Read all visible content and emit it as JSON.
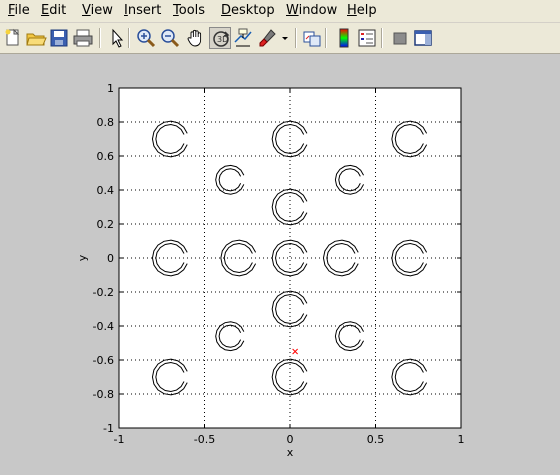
{
  "menubar": {
    "items": [
      {
        "label": "File",
        "key": "F",
        "rest": "ile"
      },
      {
        "label": "Edit",
        "key": "E",
        "rest": "dit"
      },
      {
        "label": "View",
        "key": "V",
        "rest": "iew"
      },
      {
        "label": "Insert",
        "key": "I",
        "rest": "nsert"
      },
      {
        "label": "Tools",
        "key": "T",
        "rest": "ools"
      },
      {
        "label": "Desktop",
        "key": "D",
        "rest": "esktop"
      },
      {
        "label": "Window",
        "key": "W",
        "rest": "indow"
      },
      {
        "label": "Help",
        "key": "H",
        "rest": "elp"
      }
    ]
  },
  "toolbar": {
    "buttons": [
      {
        "name": "new-figure-icon"
      },
      {
        "name": "open-file-icon"
      },
      {
        "name": "save-icon"
      },
      {
        "name": "print-icon"
      },
      {
        "name": "edit-plot-arrow-icon"
      },
      {
        "name": "zoom-in-icon"
      },
      {
        "name": "zoom-out-icon"
      },
      {
        "name": "pan-hand-icon"
      },
      {
        "name": "rotate-3d-icon",
        "active": true
      },
      {
        "name": "data-cursor-icon"
      },
      {
        "name": "brush-icon"
      },
      {
        "name": "link-plot-icon"
      },
      {
        "name": "insert-colorbar-icon"
      },
      {
        "name": "insert-legend-icon"
      },
      {
        "name": "hide-plot-tools-icon"
      },
      {
        "name": "show-plot-tools-icon"
      }
    ]
  },
  "chart_data": {
    "type": "scatter",
    "title": "",
    "xlabel": "x",
    "ylabel": "y",
    "xlim": [
      -1,
      1
    ],
    "ylim": [
      -1,
      1
    ],
    "xticks": [
      -1,
      -0.5,
      0,
      0.5,
      1
    ],
    "xtick_labels": [
      "-1",
      "-0.5",
      "0",
      "0.5",
      "1"
    ],
    "yticks": [
      -1,
      -0.8,
      -0.6,
      -0.4,
      -0.2,
      0,
      0.2,
      0.4,
      0.6,
      0.8,
      1
    ],
    "ytick_labels": [
      "-1",
      "-0.8",
      "-0.6",
      "-0.4",
      "-0.2",
      "0",
      "0.2",
      "0.4",
      "0.6",
      "0.8",
      "1"
    ],
    "grid": true,
    "grid_x": [
      -0.5,
      0,
      0.5
    ],
    "grid_y": [
      -0.8,
      -0.6,
      -0.4,
      -0.2,
      0,
      0.2,
      0.4,
      0.6,
      0.8
    ],
    "colors": {
      "background": "#c8c8c8",
      "axes": "#ffffff",
      "marker": "#000000",
      "cross": "#ff0000"
    },
    "c_markers": [
      {
        "x": -0.7,
        "y": 0.7
      },
      {
        "x": 0.0,
        "y": 0.7
      },
      {
        "x": 0.7,
        "y": 0.7
      },
      {
        "x": -0.35,
        "y": 0.46
      },
      {
        "x": 0.35,
        "y": 0.46
      },
      {
        "x": 0.0,
        "y": 0.3
      },
      {
        "x": -0.7,
        "y": 0.0
      },
      {
        "x": -0.3,
        "y": 0.0
      },
      {
        "x": 0.0,
        "y": 0.0
      },
      {
        "x": 0.3,
        "y": 0.0
      },
      {
        "x": 0.7,
        "y": 0.0
      },
      {
        "x": 0.0,
        "y": -0.3
      },
      {
        "x": -0.35,
        "y": -0.46
      },
      {
        "x": 0.35,
        "y": -0.46
      },
      {
        "x": -0.7,
        "y": -0.7
      },
      {
        "x": 0.0,
        "y": -0.7
      },
      {
        "x": 0.7,
        "y": -0.7
      }
    ],
    "c_marker_outer_radius": 0.105,
    "c_marker_small_outer_radius": 0.085,
    "c_marker_ring_gap": 0.02,
    "small_markers_index": [
      3,
      4,
      12,
      13
    ],
    "cross_points": [
      {
        "x": 0.03,
        "y": -0.55
      }
    ]
  }
}
